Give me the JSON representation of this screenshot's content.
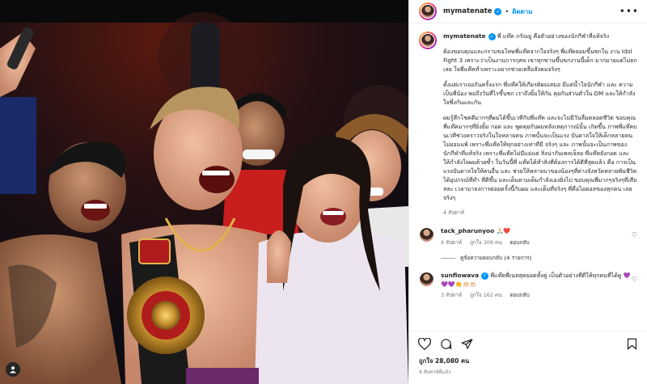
{
  "header": {
    "username": "mymatenate",
    "separator": "•",
    "follow_label": "ติดตาม",
    "more_label": "•••"
  },
  "caption": {
    "username": "mymatenate",
    "first_line": "พี่ แท๊ค ภรัณยู คือตัวอย่างของนักกีฬาที่แท้จริง",
    "paragraphs": [
      "ต้องขอบคุณและกราบขอโทษพี่แท๊คจากใจจริงๆ พี่แท๊คยอมขึ้นชกใน งาน Idol Fight 3 เพราะว่าเป็นงานการกุศล เขาทุกขานขึ้นขกงานนี้เด็ก มากมายแต่ไม่ยกเลย ใจพี่แท๊คทำเพราะอยากช่วยเหลือสังคมจริงๆ",
      "ตั้งแต่เราเจอกันครั้งแรก พี่แท๊คให้เกียรติผมเสมอ มีแต่น้ำใจนักกีฬา และ ความเป็นพี่น้อง พอถึงวันที่ไรขึ้นชก เราถึงยิ้มให้กัน คุยกันส่วนตัวใน DM และให้กำลังใจซึ่งกันและกัน",
      "ผมรู้สึกโชคดีมากๆที่ผมได้ขึ้นเวทีกับพี่แท๊ค และจะไม่มีวันลืมตลอดชีวิต ขอบคุณพี่แท๊คมากๆที่ยิ่งยิ้ม กอด และ พูดคุยกับผมหลังเหตุการณ์นั้น เกิดขึ้น ภาพพี่แท๊คบนเวทีช่วงคราวจริงในใจหลายคน ภาพนั้นจะเป็นแรง บันดาลใจให้เด็กหลายคนไม่ยอมแพ้ เพราะพี่แท๊คให้ทุกอย่างเท่าที่มี จริงๆ และ ภาพนั้นจะเป็นภาพของ นักกีฬาที่แท้จริง เพราะพี่แท๊คไม่มีแม่แต่ สิ่งน่ากันเพลเจ็ลย พี่แท๊คยังกอด และ ให้กำลังใจผมด้วยซ้ำ ในวันนี้พี่ แท๊คได้ทำสิ่งที่ต้องการได้ดีที่สุดแล้ว คือ การเป็น แรงบันดาลใจให้คนอื่น และ ช่วยให้หลายบาของน้องๆที่ต่างจังหวัดหลายพันชีวิตได้อุปกรณ์ที่ทำ ที่ดีขึ้น และเต็มตามเต็มกำลังเองยิ่งไป ขอบคุณพี่มากๆจริงๆที่เสียสละ เวลามาลงการต่อยครั้งนี้กับผม และเต็มที่จริงๆ พี่คือไอดอลของทุกคน เลยจริงๆ"
    ],
    "time": "4 สัปดาห์"
  },
  "comments": [
    {
      "username": "tack_pharunyoo",
      "text": "🙏🏻❤️",
      "time": "4 สัปดาห์",
      "likes": "ถูกใจ 309 คน",
      "reply": "ตอบกลับ",
      "view_replies": "ดูข้อความตอบกลับ (4 รายการ)"
    },
    {
      "username": "sunflowava",
      "text": "พี่แท๊คพี่เนทสุดยอดทั้งคู่ เป็นตัวอย่างที่ดีให้ทุกคนที่ได้ดู 💜💜💜👏👏🏻👏🏻",
      "time": "3 สัปดาห์",
      "likes": "ถูกใจ 162 คน",
      "reply": "ตอบกลับ"
    }
  ],
  "likes_text": "ถูกใจ 28,080 คน",
  "time_ago": "4 สัปดาห์ที่แล้ว",
  "icons": [
    "heart-icon",
    "comment-icon",
    "share-icon",
    "bookmark-icon",
    "verified-icon",
    "user-tag-icon"
  ],
  "colors": {
    "accent": "#0095f6",
    "text": "#262626",
    "muted": "#737373"
  }
}
